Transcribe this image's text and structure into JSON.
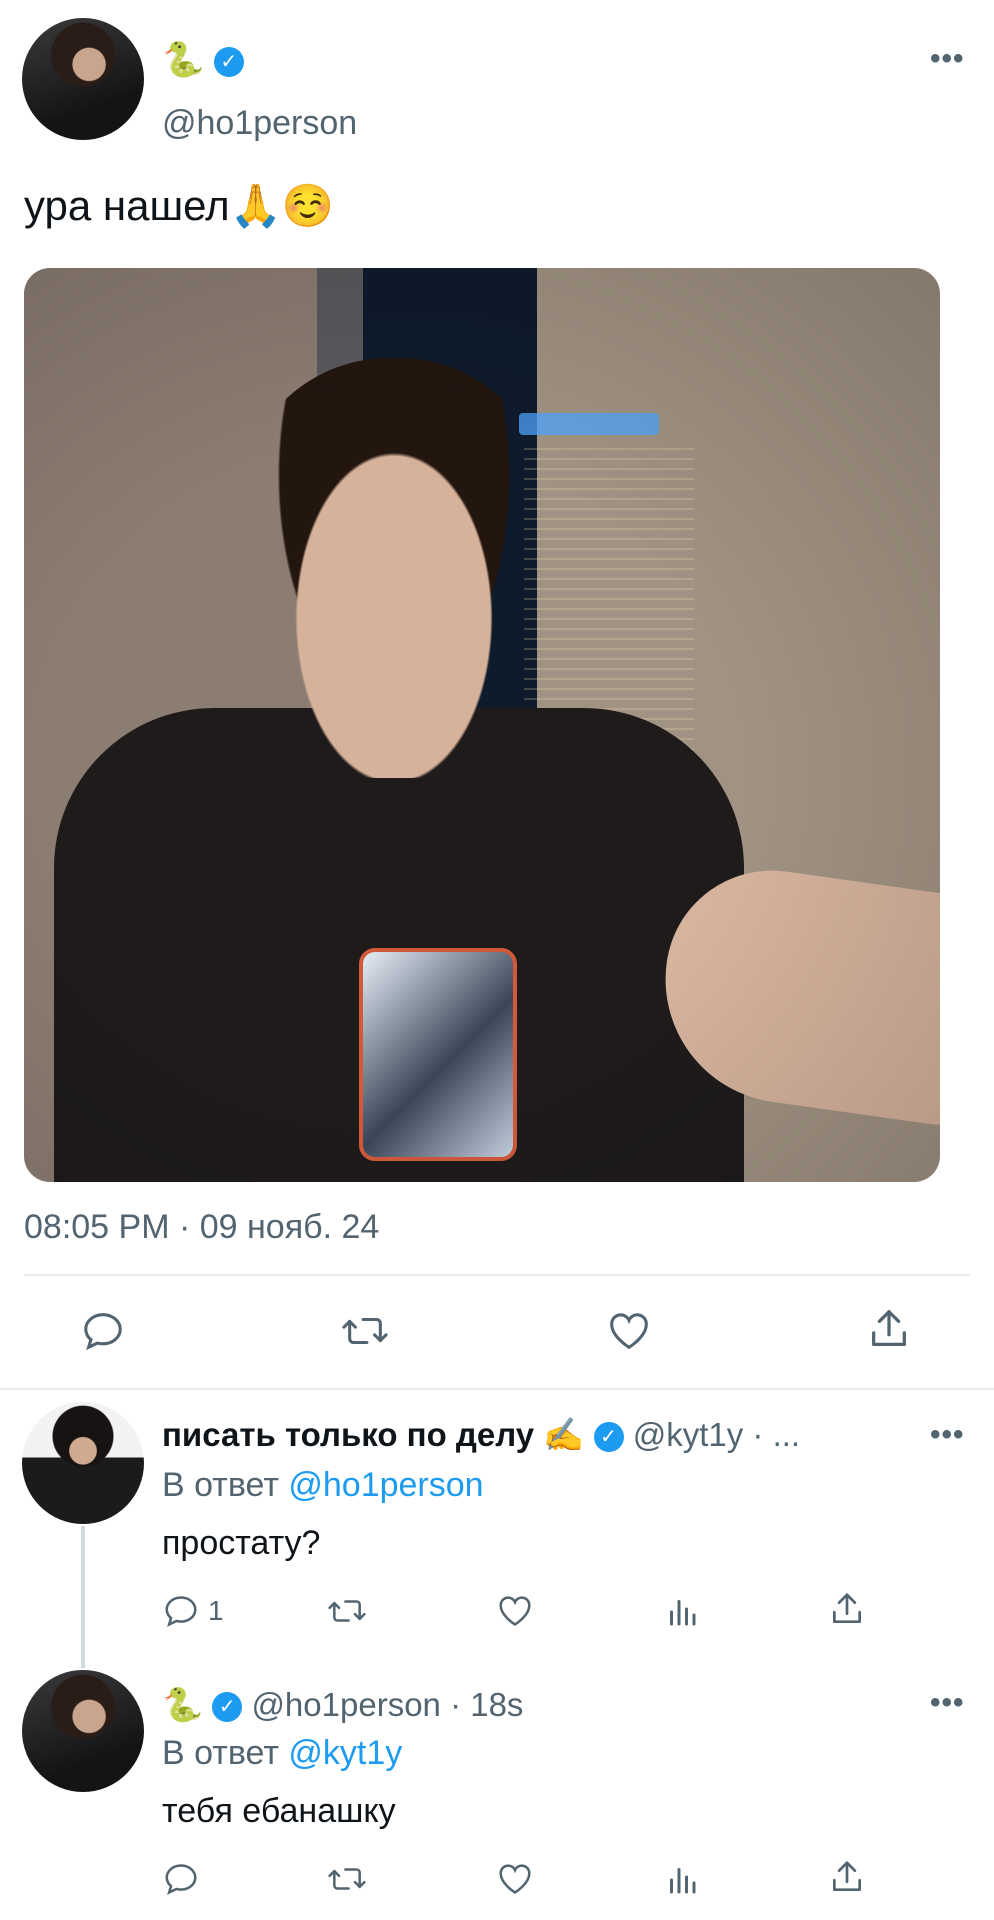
{
  "main_tweet": {
    "name_emoji": "🐍",
    "handle": "@ho1person",
    "text": "ура нашел🙏☺️",
    "timestamp": "08:05 PM · 09 нояб. 24",
    "more": "•••"
  },
  "reply1": {
    "name": "писать только по делу ✍️",
    "handle_time": "@kyt1y · ...",
    "reply_prefix": "В ответ",
    "reply_to": "@ho1person",
    "text": "простату?",
    "reply_count": "1",
    "more": "•••"
  },
  "reply2": {
    "name_emoji": "🐍",
    "handle_time": "@ho1person · 18s",
    "reply_prefix": "В ответ",
    "reply_to": "@kyt1y",
    "text": "тебя ебанашку",
    "more": "•••"
  },
  "icons": {
    "reply": "reply-icon",
    "retweet": "retweet-icon",
    "like": "like-icon",
    "views": "views-icon",
    "share": "share-icon",
    "verified": "verified-badge-icon"
  },
  "colors": {
    "accent": "#1d9bf0",
    "muted": "#536471",
    "divider": "#e6ecf0"
  }
}
